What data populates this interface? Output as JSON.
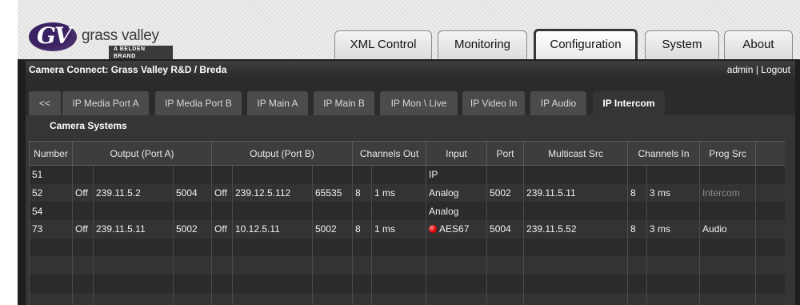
{
  "brand": {
    "name": "grass valley",
    "sub": "A BELDEN BRAND",
    "mark": "GV"
  },
  "top_tabs": [
    {
      "label": "XML Control",
      "active": false
    },
    {
      "label": "Monitoring",
      "active": false
    },
    {
      "label": "Configuration",
      "active": true
    },
    {
      "label": "System",
      "active": false
    },
    {
      "label": "About",
      "active": false
    }
  ],
  "header": {
    "title": "Camera Connect: Grass Valley R&D / Breda",
    "user": "admin",
    "separator": "|",
    "logout": "Logout"
  },
  "sub_tabs": [
    {
      "label": "<<",
      "active": false
    },
    {
      "label": "IP Media Port A",
      "active": false
    },
    {
      "label": "IP Media Port B",
      "active": false
    },
    {
      "label": "IP Main A",
      "active": false
    },
    {
      "label": "IP Main B",
      "active": false
    },
    {
      "label": "IP Mon \\ Live",
      "active": false
    },
    {
      "label": "IP Video In",
      "active": false
    },
    {
      "label": "IP Audio",
      "active": false
    },
    {
      "label": "IP Intercom",
      "active": true
    }
  ],
  "section_title": "Camera Systems",
  "table": {
    "headers": [
      "Number",
      "Output (Port A)",
      "Output (Port B)",
      "Channels Out",
      "Input",
      "Port",
      "Multicast Src",
      "Channels In",
      "Prog Src",
      ""
    ],
    "rows": [
      {
        "number": "51",
        "a_state": "",
        "a_ip": "",
        "a_port": "",
        "b_state": "",
        "b_ip": "",
        "b_port": "",
        "out_ch": "",
        "out_lat": "",
        "input": "IP",
        "input_led": false,
        "port": "",
        "mcast": "",
        "in_ch": "",
        "in_lat": "",
        "prog": "",
        "prog_dim": false
      },
      {
        "number": "52",
        "a_state": "Off",
        "a_ip": "239.11.5.2",
        "a_port": "5004",
        "b_state": "Off",
        "b_ip": "239.12.5.112",
        "b_port": "65535",
        "out_ch": "8",
        "out_lat": "1 ms",
        "input": "Analog",
        "input_led": false,
        "port": "5002",
        "mcast": "239.11.5.11",
        "in_ch": "8",
        "in_lat": "3 ms",
        "prog": "Intercom",
        "prog_dim": true
      },
      {
        "number": "54",
        "a_state": "",
        "a_ip": "",
        "a_port": "",
        "b_state": "",
        "b_ip": "",
        "b_port": "",
        "out_ch": "",
        "out_lat": "",
        "input": "Analog",
        "input_led": false,
        "port": "",
        "mcast": "",
        "in_ch": "",
        "in_lat": "",
        "prog": "",
        "prog_dim": false
      },
      {
        "number": "73",
        "a_state": "Off",
        "a_ip": "239.11.5.11",
        "a_port": "5002",
        "b_state": "Off",
        "b_ip": "10.12.5.11",
        "b_port": "5002",
        "out_ch": "8",
        "out_lat": "1 ms",
        "input": "AES67",
        "input_led": true,
        "port": "5004",
        "mcast": "239.11.5.52",
        "in_ch": "8",
        "in_lat": "3 ms",
        "prog": "Audio",
        "prog_dim": false
      },
      {},
      {},
      {},
      {}
    ]
  },
  "colors": {
    "accent": "#7a3d78",
    "logo": "#3b2262",
    "status_led": "#e00000"
  }
}
